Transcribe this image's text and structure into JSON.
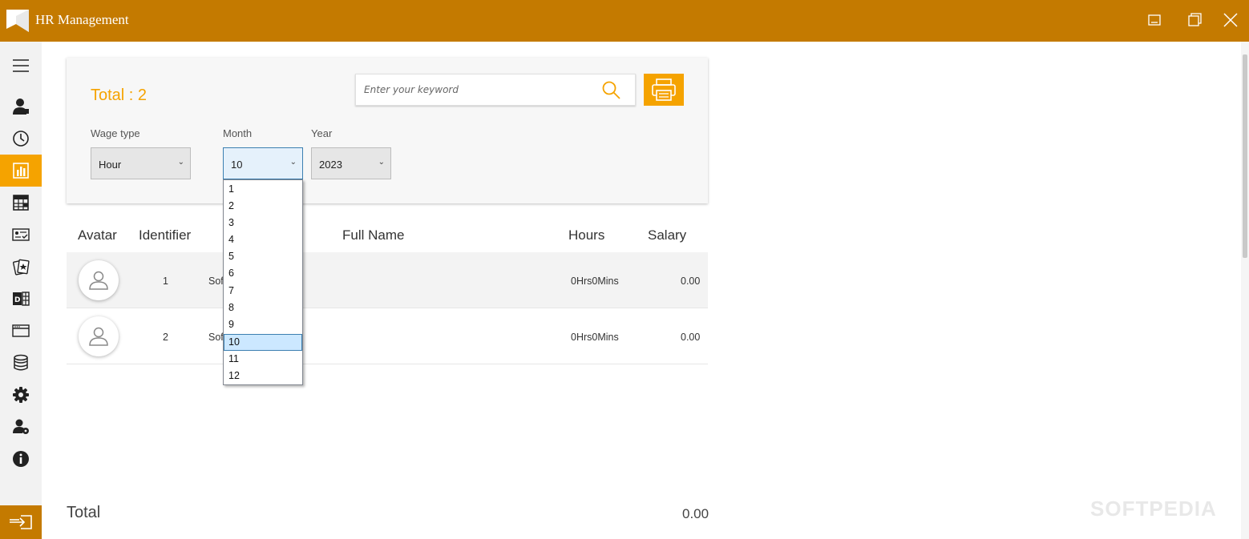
{
  "window": {
    "title": "HR Management"
  },
  "sidebar": {
    "items": [
      {
        "icon": "menu-icon"
      },
      {
        "icon": "employee-icon"
      },
      {
        "icon": "clock-icon"
      },
      {
        "icon": "report-icon",
        "active": true
      },
      {
        "icon": "calendar-grid-icon"
      },
      {
        "icon": "id-card-check-icon"
      },
      {
        "icon": "award-icon"
      },
      {
        "icon": "department-icon"
      },
      {
        "icon": "window-icon"
      },
      {
        "icon": "database-icon"
      },
      {
        "icon": "gear-icon"
      },
      {
        "icon": "user-settings-icon"
      },
      {
        "icon": "info-icon"
      }
    ],
    "logout_icon": "logout-icon"
  },
  "colors": {
    "titlebar": "#c47a00",
    "accent": "#f5a300",
    "sidebar_bg": "#f2f2f2"
  },
  "header": {
    "total_label": "Total : 2",
    "search_placeholder": "Enter your keyword"
  },
  "filters": {
    "wage_type": {
      "label": "Wage type",
      "value": "Hour"
    },
    "month": {
      "label": "Month",
      "value": "10"
    },
    "year": {
      "label": "Year",
      "value": "2023"
    }
  },
  "month_options": [
    "1",
    "2",
    "3",
    "4",
    "5",
    "6",
    "7",
    "8",
    "9",
    "10",
    "11",
    "12"
  ],
  "table": {
    "columns": [
      "Avatar",
      "Identifier",
      "Full Name",
      "Hours",
      "Salary"
    ],
    "rows": [
      {
        "identifier": "1",
        "full_name": "Sof",
        "hours": "0Hrs0Mins",
        "salary": "0.00"
      },
      {
        "identifier": "2",
        "full_name": "Sof",
        "hours": "0Hrs0Mins",
        "salary": "0.00"
      }
    ]
  },
  "footer": {
    "total_label": "Total",
    "total_value": "0.00"
  },
  "watermark": "SOFTPEDIA"
}
